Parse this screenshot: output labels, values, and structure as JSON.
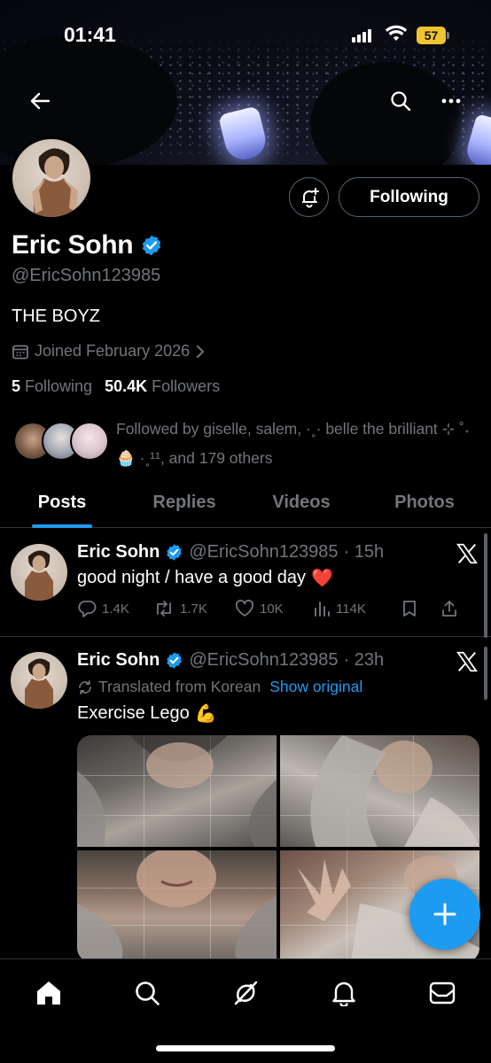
{
  "status_bar": {
    "time": "01:41",
    "battery": "57"
  },
  "profile": {
    "name": "Eric Sohn",
    "handle": "@EricSohn123985",
    "bio": "THE BOYZ",
    "joined": "Joined February 2026",
    "following_count": "5",
    "following_label": "Following",
    "followers_count": "50.4K",
    "followers_label": "Followers",
    "follow_button": "Following",
    "followed_by": "Followed by giselle, salem, ·˳· belle the brilliant ⊹ ˚˖🧁 ·˳¹¹, and 179 others"
  },
  "tabs": [
    {
      "label": "Posts",
      "active": true
    },
    {
      "label": "Replies"
    },
    {
      "label": "Videos"
    },
    {
      "label": "Photos"
    }
  ],
  "posts": [
    {
      "name": "Eric Sohn",
      "handle": "@EricSohn123985",
      "time": "· 15h",
      "text": "good night / have a good day",
      "emoji": "❤️",
      "replies": "1.4K",
      "reposts": "1.7K",
      "likes": "10K",
      "views": "114K"
    },
    {
      "name": "Eric Sohn",
      "handle": "@EricSohn123985",
      "time": "· 23h",
      "translated": "Translated from Korean",
      "show_original": "Show original",
      "text": "Exercise Lego",
      "emoji": "💪"
    }
  ],
  "icons": {
    "back": "arrow-left-icon",
    "search": "search-icon",
    "more": "more-icon",
    "notify": "bell-plus-icon",
    "calendar": "calendar-icon",
    "verified": "verified-badge-icon",
    "compose": "plus-icon",
    "nav": [
      "home-icon",
      "search-icon",
      "grok-icon",
      "notifications-icon",
      "messages-icon"
    ]
  },
  "colors": {
    "accent": "#1d9bf0",
    "background": "#000000",
    "muted": "#71767b",
    "border": "#2f3336",
    "battery": "#f0c330"
  }
}
